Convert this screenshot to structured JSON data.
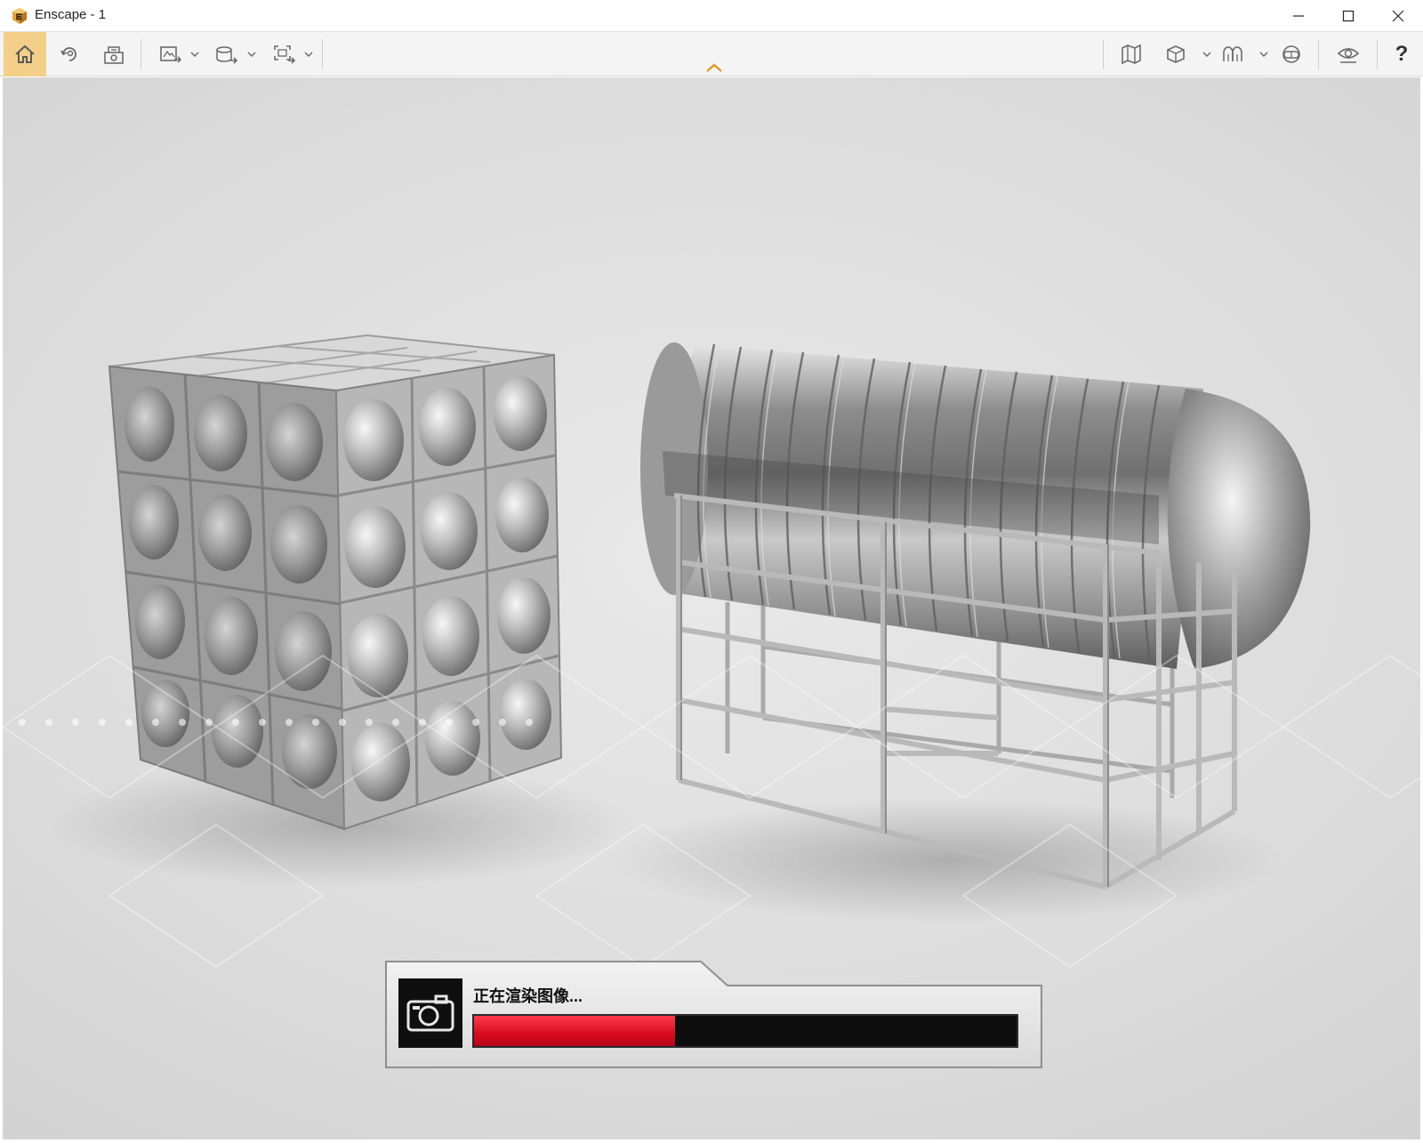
{
  "window": {
    "title": "Enscape - 1"
  },
  "toolbar": {
    "left": [
      {
        "name": "home",
        "icon": "home-icon"
      },
      {
        "name": "sync",
        "icon": "sync-icon"
      },
      {
        "name": "asset-library",
        "icon": "asset-library-icon"
      },
      {
        "name": "screenshot-export",
        "icon": "screenshot-export-icon",
        "dropdown": true
      },
      {
        "name": "panorama-export",
        "icon": "panorama-export-icon",
        "dropdown": true
      },
      {
        "name": "batch-export",
        "icon": "batch-export-icon",
        "dropdown": true
      }
    ],
    "right": [
      {
        "name": "map",
        "icon": "map-icon"
      },
      {
        "name": "view-mode",
        "icon": "cube-icon",
        "dropdown": true
      },
      {
        "name": "visual-settings",
        "icon": "visual-settings-icon",
        "dropdown": true
      },
      {
        "name": "vr-headset",
        "icon": "vr-headset-icon"
      },
      {
        "name": "walk-mode",
        "icon": "eye-icon"
      }
    ],
    "help_label": "?"
  },
  "render": {
    "status": "正在渲染图像...",
    "progress": 0.37,
    "progress_color": "#e0142a"
  },
  "colors": {
    "accent": "#f3cf87",
    "progress": "#e0142a"
  }
}
